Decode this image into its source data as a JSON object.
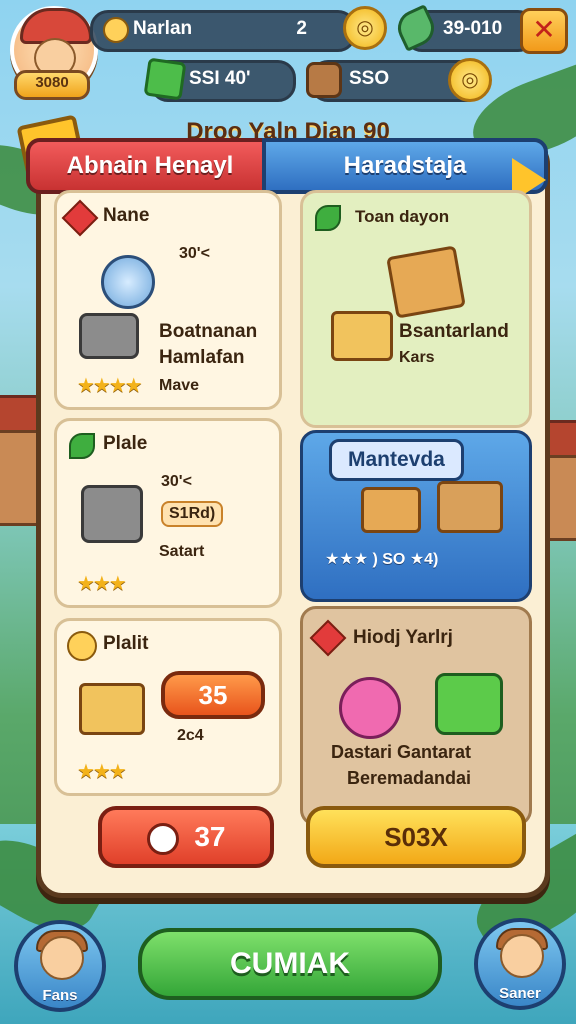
{
  "hud": {
    "level": "3080",
    "player_name": "Narlan",
    "coins_value": "2",
    "coin_icon": "coin-icon",
    "score": "39-010",
    "gems_value": "SSI 40'",
    "tickets_value": "SSO"
  },
  "panel": {
    "title": "Droo Yaln Dian 90",
    "tab_left": "Abnain Henayl",
    "tab_right": "Haradstaja"
  },
  "cards": {
    "c1": {
      "title": "Nane",
      "timer": "30'<",
      "name": "Boatnanan",
      "subname": "Hamlafan",
      "footer": "Mave",
      "stars": "★★★★"
    },
    "c2": {
      "title": "Toan dayon",
      "name": "Bsantarland",
      "subname": "Kars"
    },
    "c3": {
      "title": "Plale",
      "timer": "30'<",
      "badge": "S1Rd)",
      "footer": "Satart",
      "stars": "★★★"
    },
    "c4": {
      "title": "Mantevda",
      "footer": "★★★ ) SO ★4)"
    },
    "c5": {
      "title": "Plalit",
      "price": "35",
      "sub": "2c4",
      "stars": "★★★",
      "button": "37"
    },
    "c6": {
      "title": "Hiodj Yarlrj",
      "name": "Dastari Gantarat",
      "subname": "Beremadandai",
      "button": "S03X"
    }
  },
  "bottom": {
    "left_label": "Fans",
    "main_button": "CUMIAK",
    "right_label": "Saner"
  },
  "colors": {
    "panel": "#fbefd4",
    "border": "#5b3a1e",
    "accent_blue": "#2f6fc1",
    "accent_red": "#c83232"
  }
}
